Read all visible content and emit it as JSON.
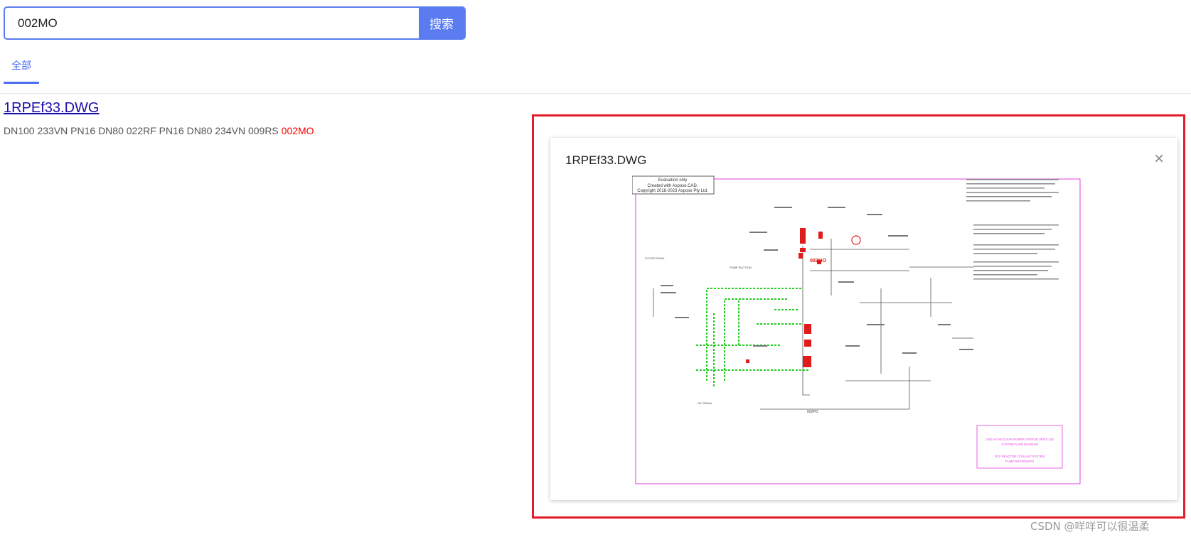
{
  "search": {
    "value": "002MO",
    "button_label": "搜索"
  },
  "tabs": [
    {
      "label": "全部"
    }
  ],
  "result": {
    "title": "1RPEf33.DWG",
    "description_prefix": "DN100 233VN PN16 DN80 022RF PN16 DN80 234VN 009RS ",
    "description_highlight": "002MO"
  },
  "preview": {
    "title": "1RPEf33.DWG",
    "drawing": {
      "stamp_line1": "Evaluation only",
      "stamp_line2": "Created with Aspose.CAD.",
      "stamp_line3": "Copyright 2018-2023 Aspose Pty Ltd.",
      "highlight_label": "002MO",
      "label_pump_suction": "PUMP SUCTION",
      "label_floor_drain": "FLOOR DRAIN",
      "label_oil_drain": "OIL DRAIN",
      "label_002po": "002PO",
      "tb_line1": "LING AO NUCLEAR POWER STATION UNITS 1&2",
      "tb_line2": "SYSTEM FLOW DIAGRAM",
      "tb_line3": "RCP REACTOR COOLANT SYSTEM",
      "tb_line4": "PUMP 001PO/002PO"
    }
  },
  "colors": {
    "accent": "#5b7cf0",
    "highlight": "#ff0000",
    "frame": "#e41b2a",
    "drawing_border": "#e040e0",
    "pipe_green": "#22cc22"
  },
  "icons": {
    "close": "close-icon"
  },
  "watermark": "CSDN @咩咩可以很温柔"
}
